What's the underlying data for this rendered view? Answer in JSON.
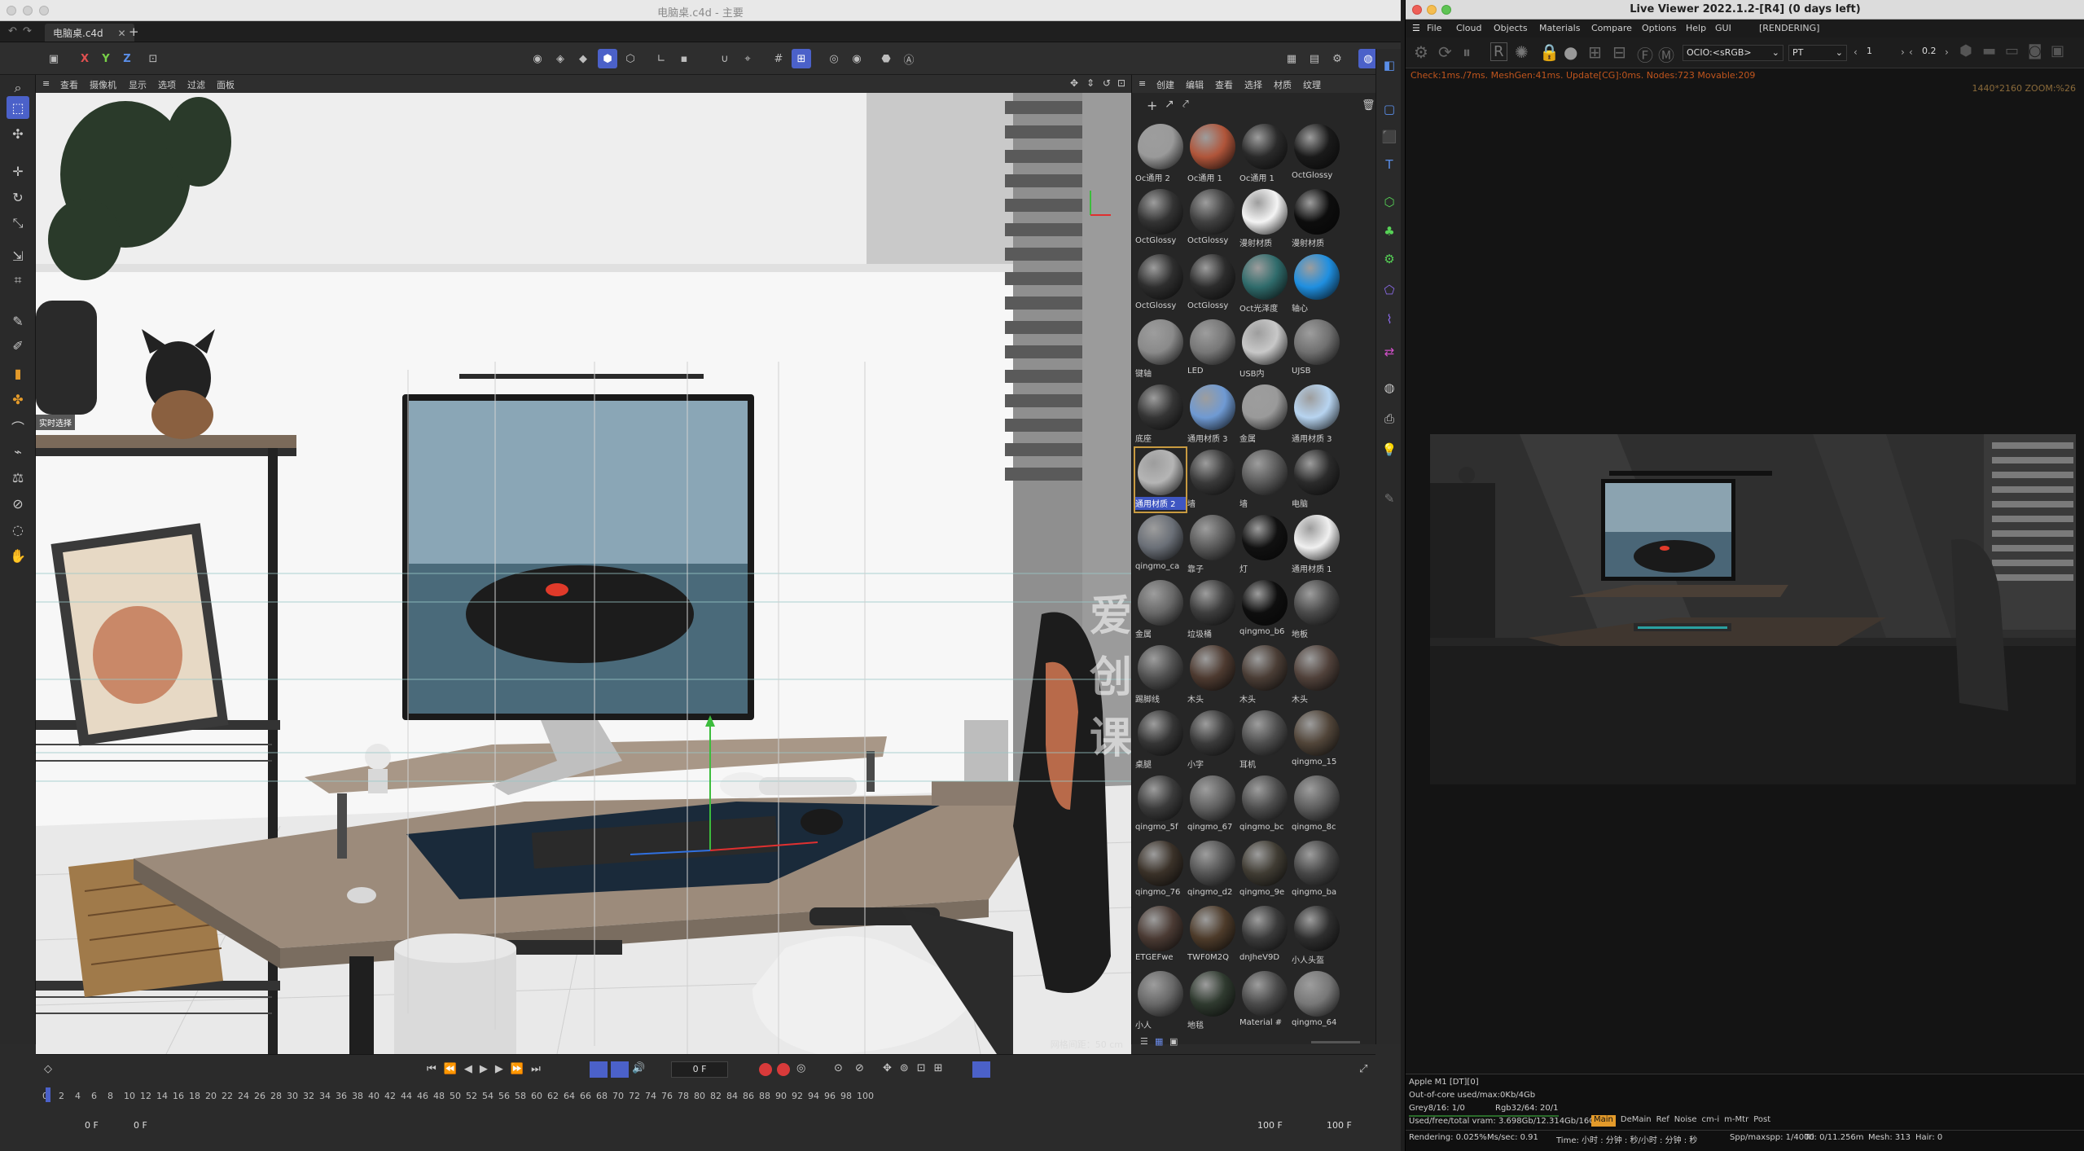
{
  "c4d": {
    "window_title": "电脑桌.c4d - 主要",
    "tab_label": "电脑桌.c4d",
    "axes": [
      "X",
      "Y",
      "Z"
    ],
    "viewport_menu": [
      "查看",
      "摄像机",
      "显示",
      "选项",
      "过滤",
      "面板"
    ],
    "viewport_tag": "实时选择",
    "grid_spacing": "网格间距：50 cm",
    "watermark": "爱创课",
    "material_menu": [
      "创建",
      "编辑",
      "查看",
      "选择",
      "材质",
      "纹理"
    ],
    "materials": [
      {
        "name": "Oc通用 2",
        "color": "#9a9a9a"
      },
      {
        "name": "Oc通用 1",
        "color": "#b0553a"
      },
      {
        "name": "Oc通用 1",
        "color": "#2a2a2a"
      },
      {
        "name": "OctGlossy",
        "color": "#1a1a1a"
      },
      {
        "name": "OctGlossy",
        "color": "#333333"
      },
      {
        "name": "OctGlossy",
        "color": "#404040"
      },
      {
        "name": "漫射材质",
        "color": "#f4f4f4"
      },
      {
        "name": "漫射材质",
        "color": "#0d0d0d"
      },
      {
        "name": "OctGlossy",
        "color": "#2e2e2e"
      },
      {
        "name": "OctGlossy",
        "color": "#2c2c2c"
      },
      {
        "name": "Oct光泽度",
        "color": "#2f6b6b"
      },
      {
        "name": "轴心",
        "color": "#1f8fe0"
      },
      {
        "name": "键轴",
        "color": "#8a8a8a"
      },
      {
        "name": "LED",
        "color": "#777777"
      },
      {
        "name": "USB内",
        "color": "#c8c8c8"
      },
      {
        "name": "UJSB",
        "color": "#707070"
      },
      {
        "name": "底座",
        "color": "#353535"
      },
      {
        "name": "通用材质 3",
        "color": "#6f9ad3"
      },
      {
        "name": "金属",
        "color": "#9a9a9a"
      },
      {
        "name": "通用材质 3",
        "color": "#b7d4f0"
      },
      {
        "name": "通用材质 2",
        "color": "#b5b5b5"
      },
      {
        "name": "墙",
        "color": "#3a3a3a"
      },
      {
        "name": "墙",
        "color": "#5a5a5a"
      },
      {
        "name": "电脑",
        "color": "#2b2b2b"
      },
      {
        "name": "qingmo_ca",
        "color": "#6a6f77"
      },
      {
        "name": "靠子",
        "color": "#5a5a5a"
      },
      {
        "name": "灯",
        "color": "#111111"
      },
      {
        "name": "通用材质 1",
        "color": "#f0f0f0"
      },
      {
        "name": "金属",
        "color": "#686868"
      },
      {
        "name": "垃圾桶",
        "color": "#3d3d3d"
      },
      {
        "name": "qingmo_b6",
        "color": "#0e0e0e"
      },
      {
        "name": "地板",
        "color": "#4a4a4a"
      },
      {
        "name": "踢脚线",
        "color": "#505050"
      },
      {
        "name": "木头",
        "color": "#4d3a30"
      },
      {
        "name": "木头",
        "color": "#4a3d35"
      },
      {
        "name": "木头",
        "color": "#50413a"
      },
      {
        "name": "桌腿",
        "color": "#353535"
      },
      {
        "name": "小字",
        "color": "#3a3a3a"
      },
      {
        "name": "耳机",
        "color": "#4e4e4e"
      },
      {
        "name": "qingmo_15",
        "color": "#514539"
      },
      {
        "name": "qingmo_5f",
        "color": "#3b3b3b"
      },
      {
        "name": "qingmo_67",
        "color": "#606060"
      },
      {
        "name": "qingmo_bc",
        "color": "#4d4d4d"
      },
      {
        "name": "qingmo_8c",
        "color": "#5d5d5d"
      },
      {
        "name": "qingmo_76",
        "color": "#3a3128"
      },
      {
        "name": "qingmo_d2",
        "color": "#545454"
      },
      {
        "name": "qingmo_9e",
        "color": "#403c33"
      },
      {
        "name": "qingmo_ba",
        "color": "#474747"
      },
      {
        "name": "ETGEFwe",
        "color": "#4a3a33"
      },
      {
        "name": "TWF0M2Q",
        "color": "#4d3b2a"
      },
      {
        "name": "dnJheV9D",
        "color": "#3a3a3a"
      },
      {
        "name": "小人头盔",
        "color": "#2e2e2e"
      },
      {
        "name": "小人",
        "color": "#686868"
      },
      {
        "name": "地毯",
        "color": "#2f3a2f"
      },
      {
        "name": "Material #",
        "color": "#4a4a4a"
      },
      {
        "name": "qingmo_64",
        "color": "#777777"
      }
    ],
    "timeline": {
      "ticks": [
        "0",
        "2",
        "4",
        "6",
        "8",
        "10",
        "12",
        "14",
        "16",
        "18",
        "20",
        "22",
        "24",
        "26",
        "28",
        "30",
        "32",
        "34",
        "36",
        "38",
        "40",
        "42",
        "44",
        "46",
        "48",
        "50",
        "52",
        "54",
        "56",
        "58",
        "60",
        "62",
        "64",
        "66",
        "68",
        "70",
        "72",
        "74",
        "76",
        "78",
        "80",
        "82",
        "84",
        "86",
        "88",
        "90",
        "92",
        "94",
        "96",
        "98",
        "100"
      ],
      "current_frame": "0 F",
      "start_frame": "0 F",
      "start_frame2": "0 F",
      "end_frame": "100 F",
      "end_frame2": "100 F"
    }
  },
  "lv": {
    "window_title": "Live Viewer 2022.1.2-[R4] (0 days left)",
    "menu": [
      "File",
      "Cloud",
      "Objects",
      "Materials",
      "Compare",
      "Options",
      "Help",
      "GUI",
      "[RENDERING]"
    ],
    "ocio": "OCIO:<sRGB>",
    "mode": "PT",
    "field1": "1",
    "field2": "0.2",
    "status": "Check:1ms./7ms. MeshGen:41ms. Update[CG]:0ms. Nodes:723 Movable:209",
    "resolution": "1440*2160 ZOOM:%26",
    "info": {
      "device": "Apple M1 [DT][0]",
      "out_of_core": "Out-of-core used/max:0Kb/4Gb",
      "grey": "Grey8/16: 1/0",
      "rgb": "Rgb32/64: 20/1",
      "vram": "Used/free/total vram: 3.698Gb/12.314Gb/16Gb",
      "rendering": "Rendering: 0.025%",
      "ms_sec": "Ms/sec: 0.91",
      "time": "Time: 小时 : 分钟 : 秒/小时 : 分钟 : 秒",
      "spp": "Spp/maxspp: 1/4000",
      "tri": "Tri: 0/11.256m",
      "mesh": "Mesh: 313",
      "hair": "Hair: 0",
      "tabs": [
        "Main",
        "DeMain",
        "Ref",
        "Noise",
        "cm-i",
        "m-Mtr",
        "Post"
      ]
    }
  },
  "colors": {
    "accent": "#4b61c9",
    "selection": "#c89a40",
    "status_orange": "#c0551d",
    "status_green": "#56d156"
  }
}
